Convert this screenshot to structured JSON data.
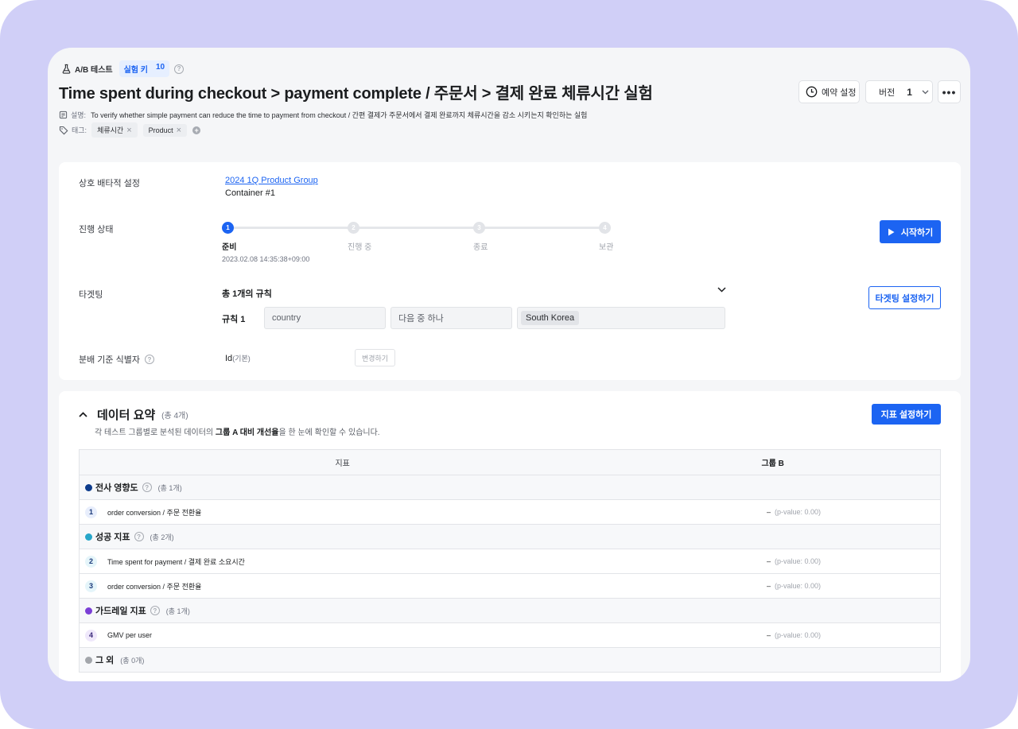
{
  "header": {
    "crumb_label": "A/B 테스트",
    "key_label": "실험 키",
    "key_value": "10",
    "title": "Time spent during checkout > payment complete / 주문서 > 결제 완료 체류시간 실험",
    "schedule_label": "예약 설정",
    "version_label": "버전",
    "version_value": "1",
    "more_label": "•••",
    "desc_label": "설명:",
    "desc_text": "To verify whether simple payment can reduce the time to payment from checkout / 간편 결제가 주문서에서 결제 완료까지 체류시간을 감소 시키는지 확인하는 실험",
    "tag_label": "태그:",
    "tags": [
      "체류시간",
      "Product"
    ]
  },
  "settings": {
    "mutual_label": "상호 배타적 설정",
    "group_link": "2024 1Q Product Group",
    "container": "Container #1",
    "status_label": "진행 상태",
    "steps": [
      {
        "num": "1",
        "label": "준비",
        "date": "2023.02.08 14:35:38+09:00"
      },
      {
        "num": "2",
        "label": "진행 중"
      },
      {
        "num": "3",
        "label": "종료"
      },
      {
        "num": "4",
        "label": "보관"
      }
    ],
    "start_label": "시작하기",
    "targeting_label": "타겟팅",
    "rule_summary": "총 1개의 규칙",
    "rule_label": "규칙 1",
    "rule_field": "country",
    "rule_op": "다음 중 하나",
    "rule_value": "South Korea",
    "targeting_btn": "타겟팅 설정하기",
    "id_label": "분배 기준 식별자",
    "id_value": "Id",
    "id_default": "(기본)",
    "change_label": "변경하기"
  },
  "summary": {
    "title": "데이터 요약",
    "count": "(총 4개)",
    "subtitle_pre": "각 테스트 그룹별로 분석된 데이터의 ",
    "subtitle_bold": "그룹 A 대비 개선율",
    "subtitle_post": "을 한 눈에 확인할 수 있습니다.",
    "metric_btn": "지표 설정하기",
    "col_metric": "지표",
    "col_group": "그룹 B",
    "groups": [
      {
        "name": "전사 영향도",
        "count": "(총 1개)",
        "color": "#0d3b8c",
        "rows": [
          {
            "num": "1",
            "name": "order conversion / 주문 전환율",
            "val": "–",
            "pval": "(p-value: 0.00)",
            "bg": "#e8eefc",
            "fg": "#1b3a7a"
          }
        ]
      },
      {
        "name": "성공 지표",
        "count": "(총 2개)",
        "color": "#27a6c9",
        "rows": [
          {
            "num": "2",
            "name": "Time spent for payment / 결제 완료 소요시간",
            "val": "–",
            "pval": "(p-value: 0.00)",
            "bg": "#e5f5fa",
            "fg": "#1b3a7a"
          },
          {
            "num": "3",
            "name": "order conversion / 주문 전환율",
            "val": "–",
            "pval": "(p-value: 0.00)",
            "bg": "#e5f5fa",
            "fg": "#1b3a7a"
          }
        ]
      },
      {
        "name": "가드레일 지표",
        "count": "(총 1개)",
        "color": "#7b3fd6",
        "rows": [
          {
            "num": "4",
            "name": "GMV per user",
            "val": "–",
            "pval": "(p-value: 0.00)",
            "bg": "#efe8fb",
            "fg": "#3b2a7a"
          }
        ]
      },
      {
        "name": "그 외",
        "count": "(총 0개)",
        "color": "#a3a6ab",
        "rows": []
      }
    ]
  }
}
